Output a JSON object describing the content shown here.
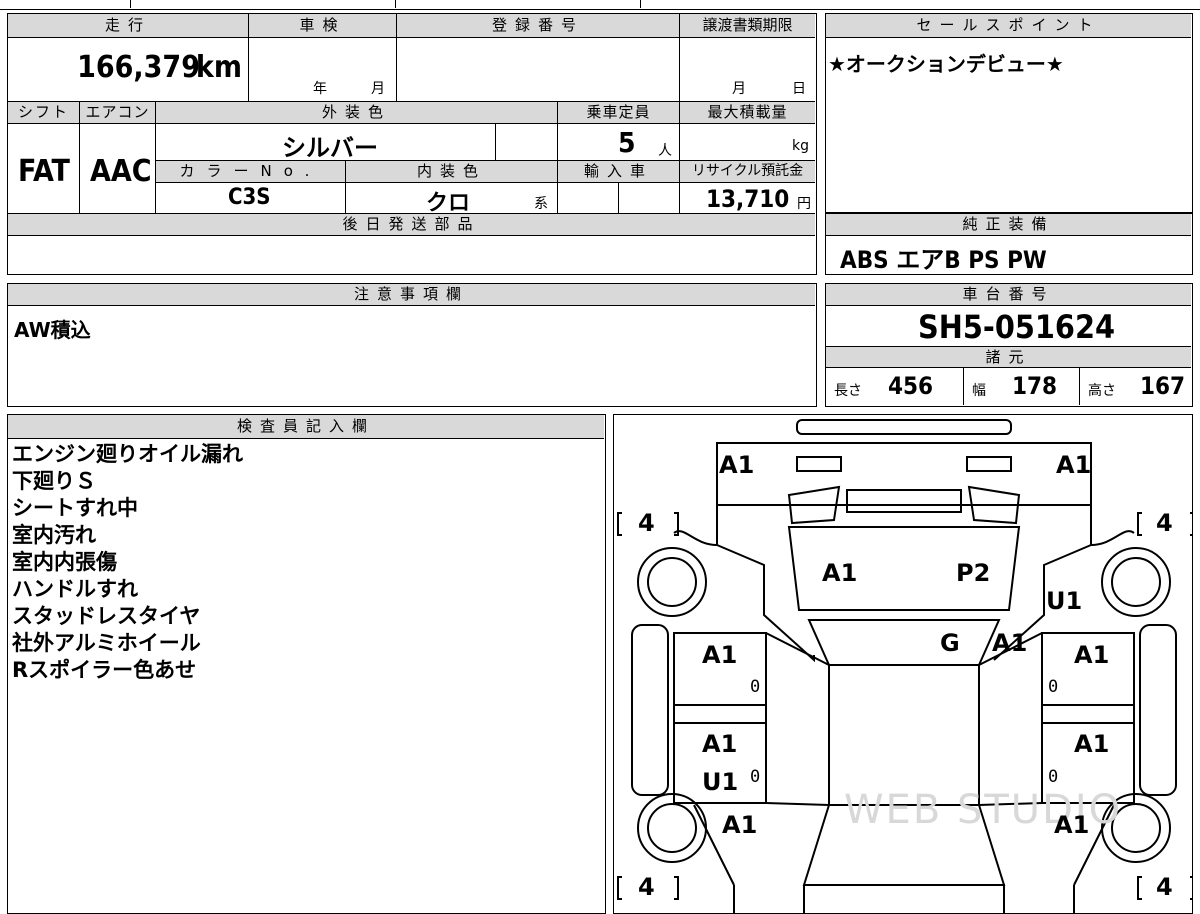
{
  "top_headers": {
    "mileage": "走行",
    "inspection": "車検",
    "registration": "登録番号",
    "transfer_deadline": "譲渡書類期限",
    "sales_point": "セールスポイント"
  },
  "mileage_value": "166,379",
  "mileage_unit": "km",
  "inspection_year": "年",
  "inspection_month": "月",
  "transfer_month": "月",
  "transfer_day": "日",
  "sales_point_text": "★オークションデビュー★",
  "row2_headers": {
    "shift": "シフト",
    "aircon": "エアコン",
    "exterior_color": "外装色",
    "capacity": "乗車定員",
    "max_load": "最大積載量"
  },
  "shift_value": "FAT",
  "aircon_value": "AAC",
  "exterior_color_value": "シルバー",
  "capacity_value": "5",
  "capacity_unit": "人",
  "max_load_unit": "kg",
  "row3_headers": {
    "color_no": "カラーNo.",
    "interior_color": "内装色",
    "import": "輸入車",
    "recycle": "リサイクル預託金"
  },
  "color_no_value": "C3S",
  "interior_color_value": "クロ",
  "interior_color_suffix": "系",
  "recycle_value": "13,710",
  "recycle_unit": "円",
  "later_parts_header": "後日発送部品",
  "genuine_equipment_header": "純正装備",
  "genuine_equipment_value": "ABS エアB PS PW",
  "caution_header": "注意事項欄",
  "caution_text": "AW積込",
  "chassis_header": "車台番号",
  "chassis_value": "SH5-051624",
  "specs_header": "諸元",
  "specs": {
    "length_label": "長さ",
    "length_value": "456",
    "width_label": "幅",
    "width_value": "178",
    "height_label": "高さ",
    "height_value": "167"
  },
  "inspector_header": "検査員記入欄",
  "inspector_notes": [
    "エンジン廻りオイル漏れ",
    "下廻りＳ",
    "シートすれ中",
    "室内汚れ",
    "室内内張傷",
    "ハンドルすれ",
    "スタッドレスタイヤ",
    "社外アルミホイール",
    "Rスポイラー色あせ"
  ],
  "diagram": {
    "marks": {
      "rear_left": "A1",
      "rear_right": "A1",
      "rear_glass_left": "A1",
      "rear_glass_right": "P2",
      "right_quarter": "U1",
      "roof": "G",
      "roof_side": "A1",
      "left_rear_door": "A1",
      "right_rear_door": "A1",
      "left_front_door": "A1",
      "left_front_door_2": "U1",
      "right_front_door": "A1",
      "left_fender": "A1",
      "right_fender": "A1"
    },
    "tire_depths": {
      "rear_left": "4",
      "rear_right": "4",
      "front_left": "4",
      "front_right": "4"
    },
    "zero_marks": "0",
    "watermark": "WEB STUDIO"
  }
}
